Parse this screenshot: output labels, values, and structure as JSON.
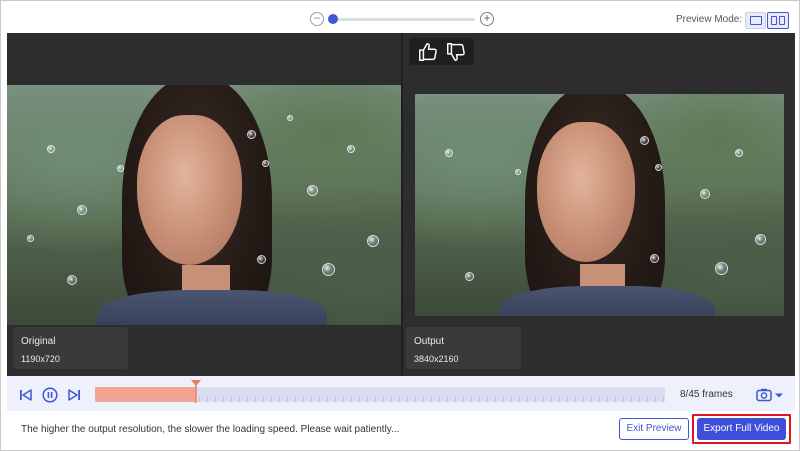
{
  "colors": {
    "accent": "#4056d8",
    "progress_fill": "#f4a38f",
    "highlight": "#e0141e"
  },
  "toolbar": {
    "zoom_out_symbol": "−",
    "zoom_in_symbol": "+",
    "preview_mode_label": "Preview Mode:",
    "icons": [
      "zoom-out-icon",
      "zoom-in-icon",
      "single-view-icon",
      "split-view-icon"
    ]
  },
  "preview": {
    "original": {
      "label": "Original",
      "resolution": "1190x720"
    },
    "output": {
      "label": "Output",
      "resolution": "3840x2160"
    },
    "rating_icons": [
      "thumbs-up-icon",
      "thumbs-down-icon"
    ]
  },
  "timeline": {
    "frames_text": "8/45 frames",
    "current_frame": 8,
    "total_frames": 45,
    "icons": [
      "previous-frame-icon",
      "pause-icon",
      "next-frame-icon",
      "snapshot-icon"
    ]
  },
  "footer": {
    "hint": "The higher the output resolution, the slower the loading speed. Please wait patiently...",
    "exit_label": "Exit Preview",
    "export_label": "Export Full Video"
  }
}
